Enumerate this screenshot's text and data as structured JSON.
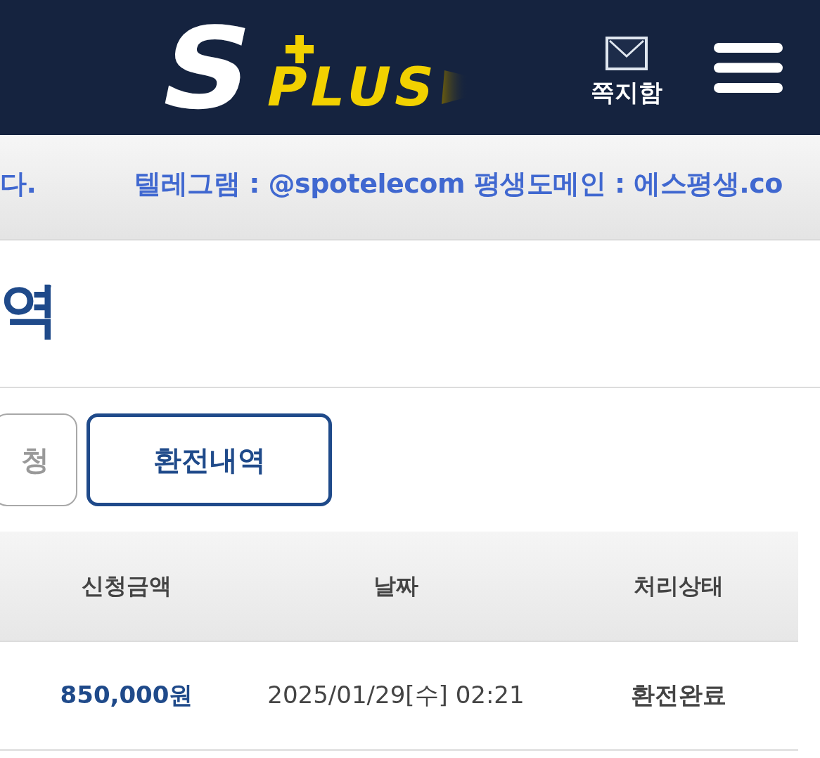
{
  "header": {
    "logo": {
      "letter": "S",
      "word": "PLUS"
    },
    "mailbox_label": "쪽지함"
  },
  "notice_ticker": [
    "다.",
    "텔레그램 : @spotelecom 평생도메인 : 에스평생.co"
  ],
  "page_title": "역",
  "tabs": [
    {
      "label": "청",
      "selected": false
    },
    {
      "label": "환전내역",
      "selected": true
    }
  ],
  "table": {
    "columns": [
      "신청금액",
      "날짜",
      "처리상태"
    ],
    "rows": [
      [
        "850,000원",
        "2025/01/29[수] 02:21",
        "환전완료"
      ]
    ]
  }
}
